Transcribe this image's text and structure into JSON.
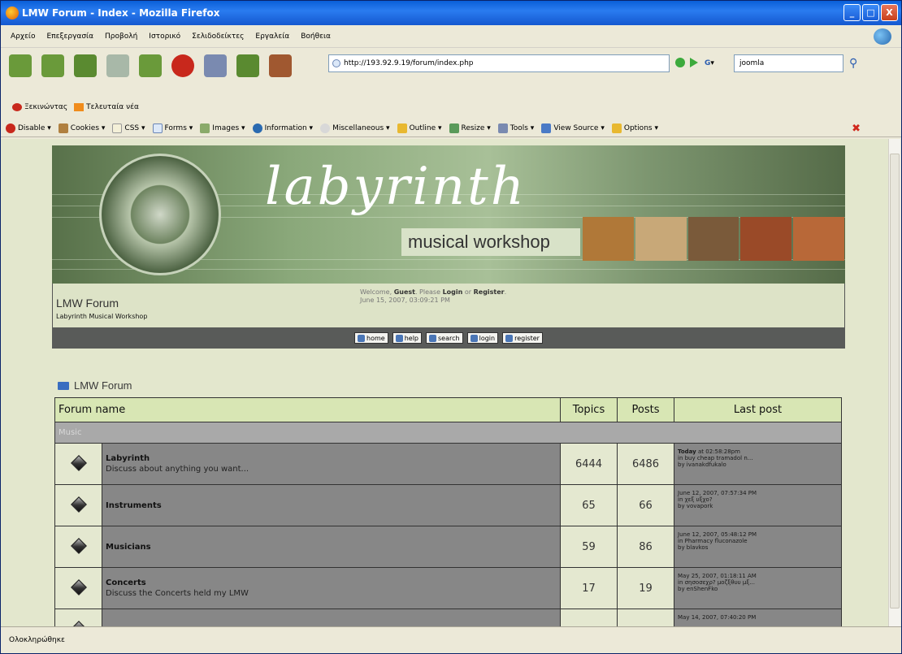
{
  "window": {
    "title": "LMW Forum - Index - Mozilla Firefox",
    "controls": {
      "minimize": "_",
      "maximize": "□",
      "close": "X"
    }
  },
  "menu": [
    "Αρχείο",
    "Επεξεργασία",
    "Προβολή",
    "Ιστορικό",
    "Σελιδοδείκτες",
    "Εργαλεία",
    "Βοήθεια"
  ],
  "navbar": {
    "url": "http://193.92.9.19/forum/index.php",
    "search_engine": "G",
    "search_text": "joomla"
  },
  "bookmarks": [
    {
      "label": "Ξεκινώντας"
    },
    {
      "label": "Τελευταία νέα"
    }
  ],
  "devtoolbar": [
    "Disable",
    "Cookies",
    "CSS",
    "Forms",
    "Images",
    "Information",
    "Miscellaneous",
    "Outline",
    "Resize",
    "Tools",
    "View Source",
    "Options"
  ],
  "banner": {
    "logo": "labyrinth",
    "logo_sub": "musical workshop"
  },
  "header": {
    "forum_title": "LMW Forum",
    "forum_subtitle": "Labyrinth Musical Workshop",
    "welcome_prefix": "Welcome, ",
    "guest": "Guest",
    "please": ". Please ",
    "login": "Login",
    "or": " or ",
    "register": "Register",
    "period": ".",
    "date": "June 15, 2007, 03:09:21 PM"
  },
  "forum_menu": [
    "home",
    "help",
    "search",
    "login",
    "register"
  ],
  "breadcrumb": "LMW Forum",
  "table": {
    "headers": {
      "name": "Forum name",
      "topics": "Topics",
      "posts": "Posts",
      "last": "Last post"
    },
    "category": "Music",
    "rows": [
      {
        "name": "Labyrinth",
        "desc": "Discuss about anything you want...",
        "topics": "6444",
        "posts": "6486",
        "last1": "Today",
        "last1b": " at 02:58:28pm",
        "last2": "in buy cheap tramadol n...",
        "last3": "by ivanakdfukalo"
      },
      {
        "name": "Instruments",
        "desc": "",
        "topics": "65",
        "posts": "66",
        "last1": "",
        "last1b": "June 12, 2007, 07:57:34 PM",
        "last2": "in χεξ υξχο?",
        "last3": "by vovapork"
      },
      {
        "name": "Musicians",
        "desc": "",
        "topics": "59",
        "posts": "86",
        "last1": "",
        "last1b": "June 12, 2007, 05:48:12 PM",
        "last2": "in Pharmacy fluconazole",
        "last3": "by blavkos"
      },
      {
        "name": "Concerts",
        "desc": "Discuss the Concerts held my LMW",
        "topics": "17",
        "posts": "19",
        "last1": "",
        "last1b": "May 25, 2007, 01:18:11 AM",
        "last2": "in σησοσεχρ? μοζξθυυ μξ...",
        "last3": "by enShenFko"
      },
      {
        "name": "",
        "desc": "",
        "topics": "",
        "posts": "",
        "last1": "",
        "last1b": "May 14, 2007, 07:40:20 PM",
        "last2": "",
        "last3": ""
      }
    ]
  },
  "status": "Ολοκληρώθηκε"
}
